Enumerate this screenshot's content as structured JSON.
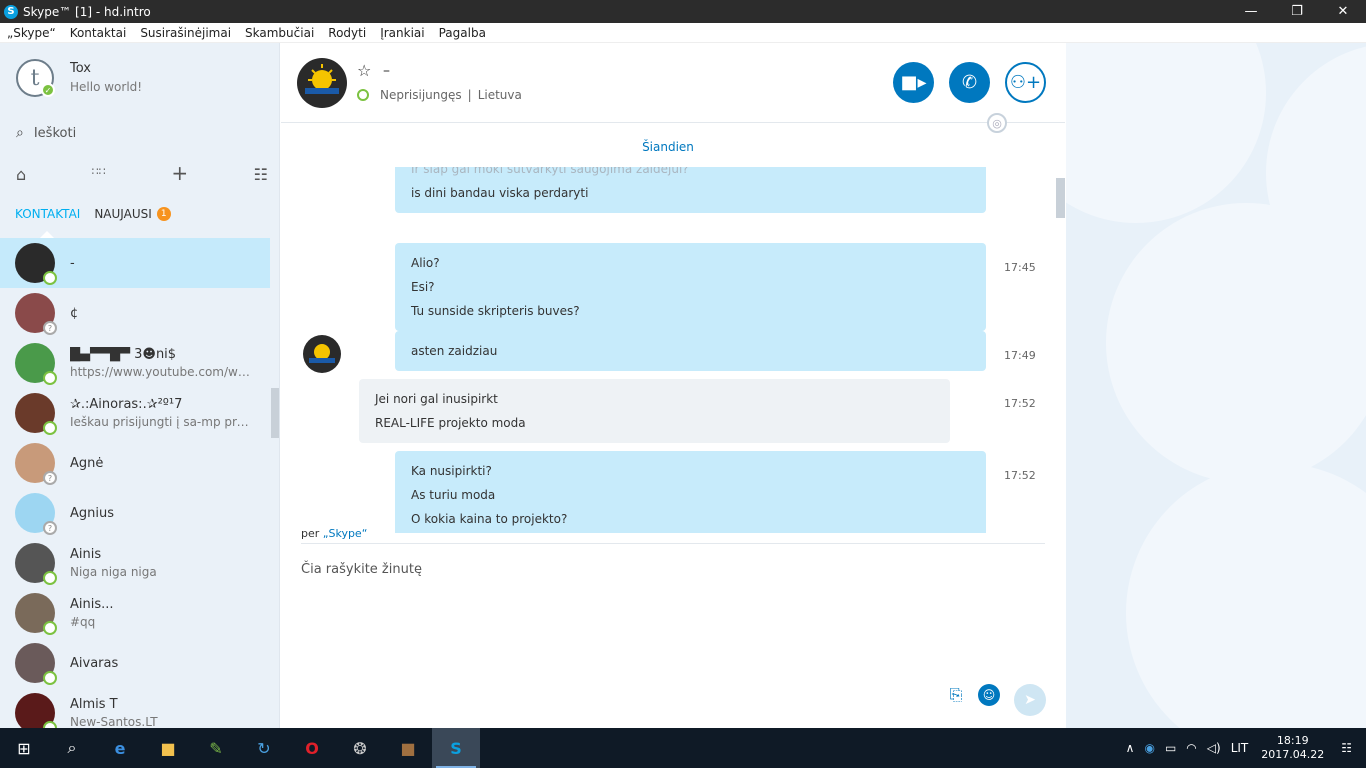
{
  "window": {
    "title": "Skype™ [1] - hd.intro",
    "min": "—",
    "max": "❐",
    "close": "✕"
  },
  "menu": [
    "„Skype“",
    "Kontaktai",
    "Susirašinėjimai",
    "Skambučiai",
    "Rodyti",
    "Įrankiai",
    "Pagalba"
  ],
  "profile": {
    "avatar_letter": "t",
    "name": "Tox",
    "mood": "Hello world!"
  },
  "search": {
    "placeholder": "Ieškoti"
  },
  "tabs": {
    "contacts": "KONTAKTAI",
    "recent": "NAUJAUSI",
    "recent_badge": "1"
  },
  "contacts": [
    {
      "name": "-",
      "mood": "",
      "status": "online",
      "color": "#2a2a2a"
    },
    {
      "name": "¢",
      "mood": "",
      "status": "unknown",
      "color": "#8a4a4a"
    },
    {
      "name": "█▄▀▀█▀ 3☻ni$",
      "mood": "https://www.youtube.com/watc...",
      "status": "online",
      "color": "#4a9a4a"
    },
    {
      "name": "✰.:Ainoras:.✰²º¹7",
      "mood": "Ieškau prisijungti į sa-mp projekta",
      "status": "online",
      "color": "#6a3a2a"
    },
    {
      "name": "Agnė",
      "mood": "",
      "status": "unknown",
      "color": "#c89a7a"
    },
    {
      "name": "Agnius",
      "mood": "",
      "status": "unknown",
      "color": "#9dd6f2"
    },
    {
      "name": "Ainis",
      "mood": "Niga niga niga",
      "status": "online",
      "color": "#555"
    },
    {
      "name": "Ainis...",
      "mood": "#qq",
      "status": "online",
      "color": "#7a6a5a"
    },
    {
      "name": "Aivaras",
      "mood": "",
      "status": "online",
      "color": "#6a5a5a"
    },
    {
      "name": "Almis T",
      "mood": "New-Santos.LT",
      "status": "online",
      "color": "#5a1a1a"
    }
  ],
  "chat": {
    "name": "–",
    "status": "Neprisijungęs",
    "location": "Lietuva",
    "today": "Šiandien",
    "messages": [
      {
        "lines": [
          "Ir siap gal moki sutvarkyti saugojima zaidejui?",
          "is dini bandau viska perdaryti"
        ],
        "time": ""
      },
      {
        "lines": [
          "Alio?",
          "Esi?",
          "Tu sunside skripteris buves?"
        ],
        "time": "17:45"
      },
      {
        "lines": [
          "asten zaidziau"
        ],
        "time": "17:49"
      },
      {
        "lines": [
          "Jei nori gal inusipirkt",
          "REAL-LIFE projekto moda"
        ],
        "time": "17:52"
      },
      {
        "lines": [
          "Ka nusipirkti?",
          "As turiu moda",
          "O kokia kaina to projekto?"
        ],
        "time": "17:52"
      }
    ],
    "via_prefix": "per",
    "via_name": "„Skype“",
    "compose_placeholder": "Čia rašykite žinutę"
  },
  "tray": {
    "lang": "LIT",
    "time": "18:19",
    "date": "2017.04.22"
  },
  "colors": {
    "accent": "#0078bf",
    "sky": "#00aff0",
    "bubble_out": "#c7ebfb",
    "online": "#7cc241"
  }
}
